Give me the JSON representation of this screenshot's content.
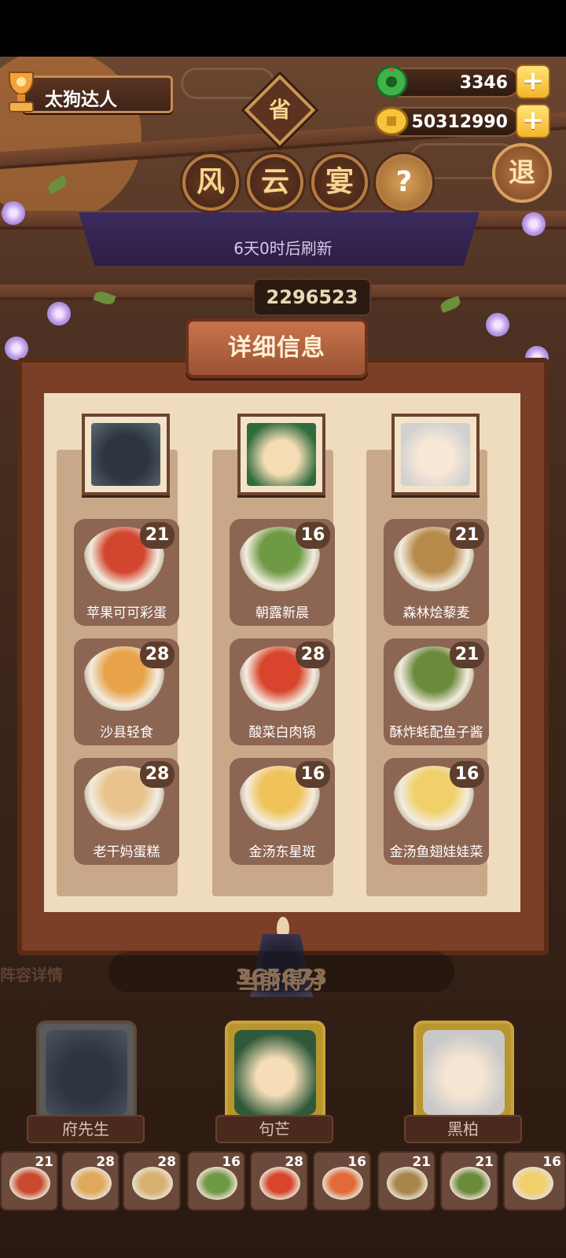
{
  "player": {
    "name": "太狗达人"
  },
  "currencies": {
    "jade": "3346",
    "gold": "50312990",
    "plus": "+"
  },
  "header": {
    "badge": "省",
    "title_chars": [
      "风",
      "云",
      "宴"
    ],
    "help": "?",
    "exit": "退",
    "refresh_text": "6天0时后刷新",
    "score": "2296523"
  },
  "detail": {
    "title": "详细信息",
    "columns": [
      {
        "dishes": [
          {
            "name": "苹果可可彩蛋",
            "level": "21"
          },
          {
            "name": "沙县轻食",
            "level": "28"
          },
          {
            "name": "老干妈蛋糕",
            "level": "28"
          }
        ]
      },
      {
        "dishes": [
          {
            "name": "朝露新晨",
            "level": "16"
          },
          {
            "name": "酸菜白肉锅",
            "level": "28"
          },
          {
            "name": "金汤东星斑",
            "level": "16"
          }
        ]
      },
      {
        "dishes": [
          {
            "name": "森林烩藜麦",
            "level": "21"
          },
          {
            "name": "酥炸蚝配鱼子酱",
            "level": "21"
          },
          {
            "name": "金汤鱼翅娃娃菜",
            "level": "16"
          }
        ]
      }
    ]
  },
  "bottom": {
    "lineup_label": "阵容详情",
    "current_score_label": "当前得分",
    "current_score": "365673",
    "chefs": [
      {
        "name": "府先生"
      },
      {
        "name": "句芒"
      },
      {
        "name": "黑柏"
      }
    ],
    "mini_dishes": [
      "21",
      "28",
      "28",
      "16",
      "28",
      "16",
      "21",
      "21",
      "16"
    ]
  },
  "colors": {
    "paper": "#efdcbf",
    "wood": "#7a3f26",
    "accent": "#f4b528"
  }
}
